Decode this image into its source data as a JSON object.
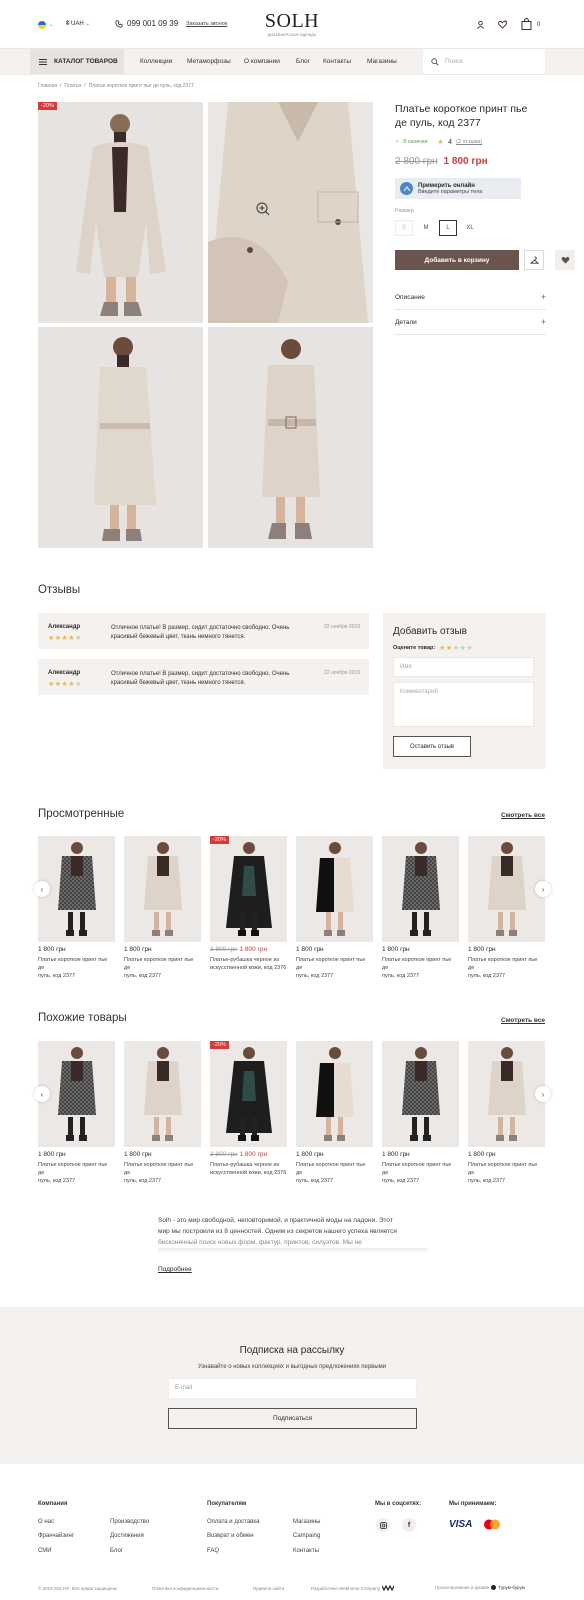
{
  "header": {
    "language": "UA",
    "currency": "₴ UAH",
    "phone": "099 001 09 39",
    "callback": "Заказать звонок",
    "logo": "SOLH",
    "logo_sub": "ДИЗАЙНЕРСКАЯ ОДЕЖДА",
    "cart_count": "0"
  },
  "nav": {
    "catalog": "КАТАЛОГ ТОВАРОВ",
    "items": [
      "Коллекции",
      "Метаморфозы",
      "О компании",
      "Блог",
      "Контакты",
      "Магазины"
    ],
    "search_placeholder": "Поиск"
  },
  "breadcrumb": [
    "Главная",
    "Платья",
    "Платье короткое принт пье де пуль, код 2377"
  ],
  "product": {
    "discount": "-20%",
    "title_line1": "Платье короткое принт пье",
    "title_line2": "де пуль, код 2377",
    "stock": "В наличии",
    "rating": "4",
    "reviews_link": "(2 отзыва)",
    "old_price": "2 800 грн",
    "new_price": "1 800 грн",
    "tryon_title": "Примерить онлайн",
    "tryon_sub": "Введите параметры тела",
    "size_label": "Размер",
    "sizes": [
      "S",
      "M",
      "L",
      "XL"
    ],
    "selected_size": "L",
    "add_to_cart": "Добавить в корзину",
    "accordion": [
      "Описание",
      "Детали"
    ]
  },
  "reviews": {
    "title": "Отзывы",
    "items": [
      {
        "author": "Александр",
        "text1": "Отличное платье! В размер, сидит достаточно свободно. Очень",
        "text2": "красивый бежевый цвет, ткань немного тянется.",
        "date": "22 ноября 2019",
        "rating": 4
      },
      {
        "author": "Александр",
        "text1": "Отличное платье! В размер, сидит достаточно свободно. Очень",
        "text2": "красивый бежевый цвет, ткань немного тянется.",
        "date": "22 ноября 2019",
        "rating": 4
      }
    ],
    "form_title": "Добавить отзыв",
    "rate_label": "Оцените товар:",
    "name_placeholder": "Имя",
    "comment_placeholder": "Комментарий",
    "submit": "Оставить отзыв"
  },
  "viewed": {
    "title": "Просмотренные",
    "see_all": "Смотреть все",
    "cards": [
      {
        "price": "1 800 грн",
        "old": "",
        "title1": "Платье короткое принт пье де",
        "title2": "пуль, код 2377",
        "variant": "check"
      },
      {
        "price": "1 800 грн",
        "old": "",
        "title1": "Платье короткое принт пье де",
        "title2": "пуль, код 2377",
        "variant": "beige"
      },
      {
        "price": "1 800 грн",
        "old": "3 800 грн",
        "badge": "-20%",
        "title1": "Платье-рубашка черное из",
        "title2": "искусственной кожи, код 2376",
        "variant": "black"
      },
      {
        "price": "1 800 грн",
        "old": "",
        "title1": "Платье короткое принт пье де",
        "title2": "пуль, код 2377",
        "variant": "split"
      },
      {
        "price": "1 800 грн",
        "old": "",
        "title1": "Платье короткое принт пье де",
        "title2": "пуль, код 2377",
        "variant": "check"
      },
      {
        "price": "1 800 грн",
        "old": "",
        "title1": "Платье короткое принт пье де",
        "title2": "пуль, код 2377",
        "variant": "beige"
      }
    ]
  },
  "similar": {
    "title": "Похожие товары",
    "see_all": "Смотреть все",
    "cards": [
      {
        "price": "1 800 грн",
        "old": "",
        "title1": "Платье короткое принт пье де",
        "title2": "пуль, код 2377",
        "variant": "check"
      },
      {
        "price": "1 800 грн",
        "old": "",
        "title1": "Платье короткое принт пье де",
        "title2": "пуль, код 2377",
        "variant": "beige"
      },
      {
        "price": "1 800 грн",
        "old": "3 800 грн",
        "badge": "-20%",
        "title1": "Платье-рубашка черное из",
        "title2": "искусственной кожи, код 2376",
        "variant": "black"
      },
      {
        "price": "1 800 грн",
        "old": "",
        "title1": "Платье короткое принт пье де",
        "title2": "пуль, код 2377",
        "variant": "split"
      },
      {
        "price": "1 800 грн",
        "old": "",
        "title1": "Платье короткое принт пье де",
        "title2": "пуль, код 2377",
        "variant": "check"
      },
      {
        "price": "1 800 грн",
        "old": "",
        "title1": "Платье короткое принт пье де",
        "title2": "пуль, код 2377",
        "variant": "beige"
      }
    ]
  },
  "about": {
    "line1": "Solh - это мир свободной, неповторимой, и практичной моды на ладони.  Этот",
    "line2": "мир мы построили из 8 ценностей. Одним из секретов нашего успеха является",
    "line3": "бесконечный поиск новых форм, фактур, принтов, силуэтов. Мы не",
    "more": "Подробнее"
  },
  "newsletter": {
    "title": "Подписка на рассылку",
    "subtitle": "Узнавайте о новых коллекциях и выгодных предложениях первыми",
    "email_placeholder": "E-mail",
    "button": "Подписаться"
  },
  "footer": {
    "company_title": "Компания",
    "company_col1": [
      "О нас",
      "Франчайзинг",
      "СМИ"
    ],
    "company_col2": [
      "Производство",
      "Достижения",
      "Блог"
    ],
    "buyers_title": "Покупателям",
    "buyers_col1": [
      "Оплата и доставка",
      "Возврат и обмен",
      "FAQ"
    ],
    "buyers_col2": [
      "Магазины",
      "Campaing",
      "Контакты"
    ],
    "social_title": "Мы в соцсетях:",
    "payment_title": "Мы принимаем:",
    "visa": "VISA",
    "copyright": "© 2019 SOLH®. Все права защищены",
    "privacy": "Политика конфиденциальности",
    "rules": "Правила сайта",
    "dev": "Разработано Webhome Company",
    "design": "Проектирование и дизайн",
    "design_by": "Турум-бурум"
  },
  "colors": {
    "accent": "#d83a3a",
    "brand_brown": "#6a554d",
    "star": "#f2b833",
    "beige_bg": "#f4f1ef"
  }
}
